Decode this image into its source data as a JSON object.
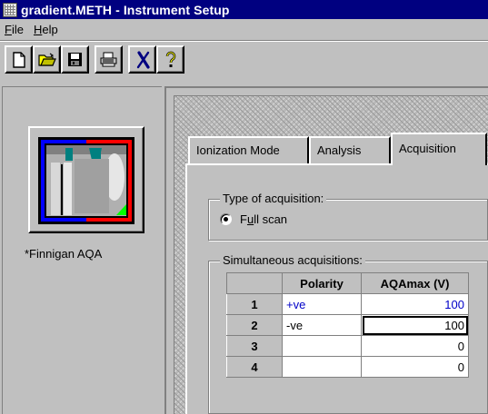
{
  "window": {
    "title": "gradient.METH - Instrument Setup",
    "icon": "grid-icon"
  },
  "menu": {
    "items": [
      {
        "label": "File",
        "mnemonic": "F"
      },
      {
        "label": "Help",
        "mnemonic": "H"
      }
    ]
  },
  "toolbar": {
    "buttons": [
      {
        "icon": "new-document-icon"
      },
      {
        "icon": "open-folder-icon"
      },
      {
        "icon": "save-disk-icon"
      },
      {
        "icon": "print-icon"
      },
      {
        "icon": "italic-x-icon"
      },
      {
        "icon": "help-question-icon"
      }
    ]
  },
  "instrument": {
    "label": "*Finnigan AQA",
    "colors": {
      "frame_red": "#ff0000",
      "frame_blue": "#0000ff",
      "corner_green": "#00ff00",
      "teal": "#008080"
    }
  },
  "tabs": [
    {
      "label": "Ionization Mode",
      "active": false
    },
    {
      "label": "Analysis",
      "active": false
    },
    {
      "label": "Acquisition",
      "active": true
    }
  ],
  "acquisition": {
    "type_group_label": "Type of acquisition:",
    "mode_label": "Full scan",
    "mode_mnemonic": "u",
    "mode_selected": true,
    "simultaneous_label": "Simultaneous acquisitions:",
    "columns": [
      "Polarity",
      "AQAmax (V)"
    ],
    "rows": [
      {
        "num": "1",
        "polarity": "+ve",
        "aqamax": "100",
        "highlight": true
      },
      {
        "num": "2",
        "polarity": "-ve",
        "aqamax": "100",
        "highlight": false
      },
      {
        "num": "3",
        "polarity": "",
        "aqamax": "0",
        "highlight": false
      },
      {
        "num": "4",
        "polarity": "",
        "aqamax": "0",
        "highlight": false
      }
    ]
  }
}
